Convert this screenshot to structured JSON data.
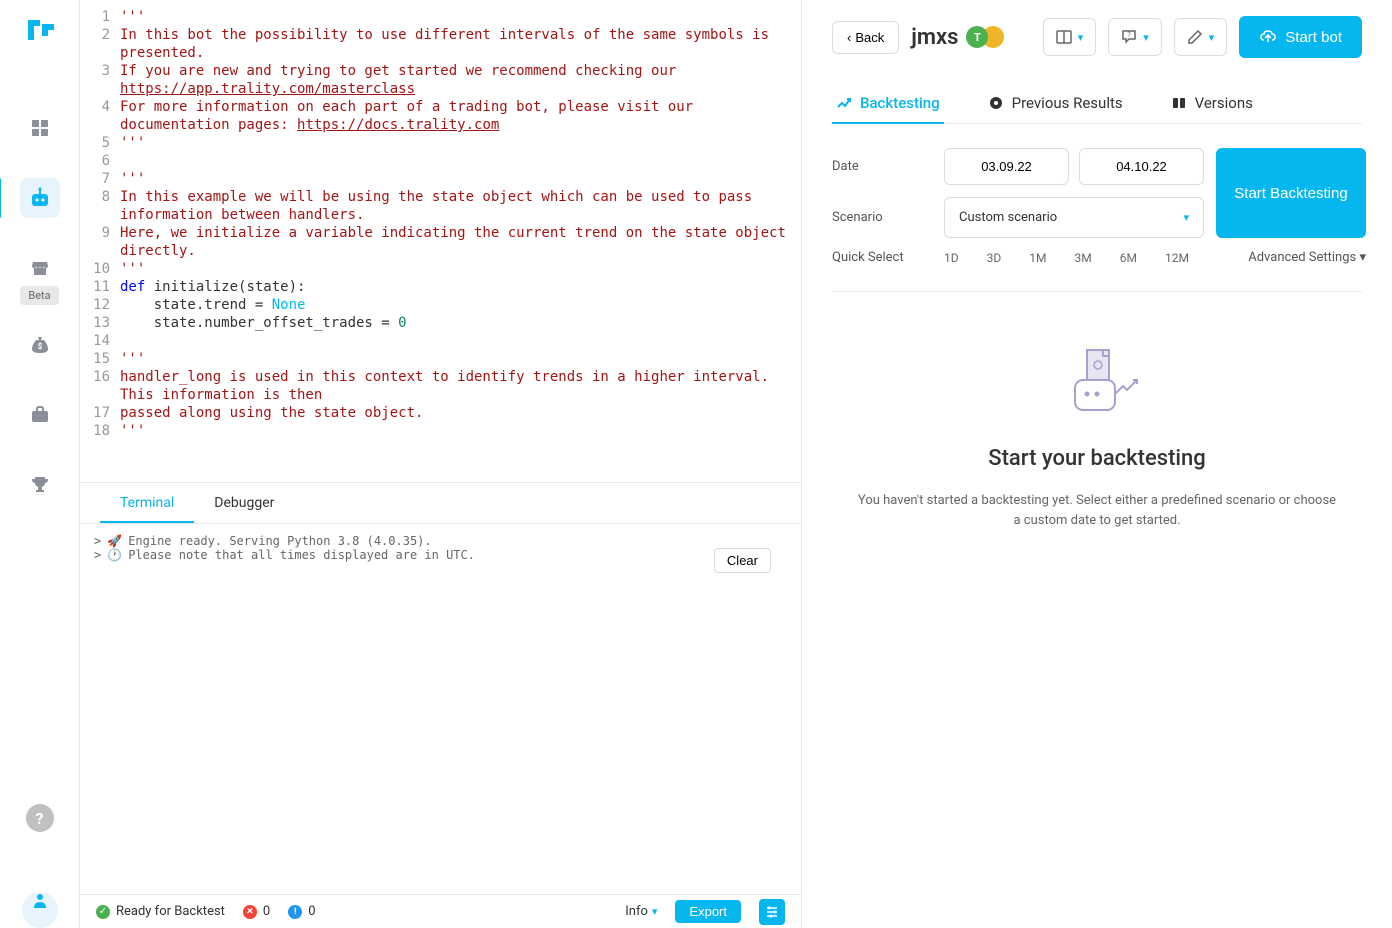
{
  "sidebar": {
    "beta_label": "Beta"
  },
  "editor": {
    "code_lines": [
      {
        "n": 1,
        "tokens": [
          {
            "t": "'''",
            "c": "str"
          }
        ]
      },
      {
        "n": 2,
        "tokens": [
          {
            "t": "In this bot the possibility to use different intervals of the same symbols is presented.",
            "c": "str"
          }
        ]
      },
      {
        "n": 3,
        "tokens": [
          {
            "t": "If you are new and trying to get started we recommend checking our ",
            "c": "str"
          },
          {
            "t": "https://app.trality.com/masterclass",
            "c": "str lnk"
          }
        ]
      },
      {
        "n": 4,
        "tokens": [
          {
            "t": "For more information on each part of a trading bot, please visit our documentation pages: ",
            "c": "str"
          },
          {
            "t": "https://docs.trality.com",
            "c": "str lnk"
          }
        ]
      },
      {
        "n": 5,
        "tokens": [
          {
            "t": "'''",
            "c": "str"
          }
        ]
      },
      {
        "n": 6,
        "tokens": [
          {
            "t": "",
            "c": ""
          }
        ]
      },
      {
        "n": 7,
        "tokens": [
          {
            "t": "'''",
            "c": "str"
          }
        ]
      },
      {
        "n": 8,
        "tokens": [
          {
            "t": "In this example we will be using the state object which can be used to pass information between handlers.",
            "c": "str"
          }
        ]
      },
      {
        "n": 9,
        "tokens": [
          {
            "t": "Here, we initialize a variable indicating the current trend on the state object directly.",
            "c": "str"
          }
        ]
      },
      {
        "n": 10,
        "tokens": [
          {
            "t": "'''",
            "c": "str"
          }
        ]
      },
      {
        "n": 11,
        "tokens": [
          {
            "t": "def",
            "c": "kw"
          },
          {
            "t": " initialize(state):",
            "c": ""
          }
        ]
      },
      {
        "n": 12,
        "tokens": [
          {
            "t": "    state.trend = ",
            "c": ""
          },
          {
            "t": "None",
            "c": "kw2"
          }
        ]
      },
      {
        "n": 13,
        "tokens": [
          {
            "t": "    state.number_offset_trades = ",
            "c": ""
          },
          {
            "t": "0",
            "c": "num"
          }
        ]
      },
      {
        "n": 14,
        "tokens": [
          {
            "t": "",
            "c": ""
          }
        ]
      },
      {
        "n": 15,
        "tokens": [
          {
            "t": "'''",
            "c": "str"
          }
        ]
      },
      {
        "n": 16,
        "tokens": [
          {
            "t": "handler_long is used in this context to identify trends in a higher interval. This information is then",
            "c": "str"
          }
        ]
      },
      {
        "n": 17,
        "tokens": [
          {
            "t": "passed along using the state object.",
            "c": "str"
          }
        ]
      },
      {
        "n": 18,
        "tokens": [
          {
            "t": "'''",
            "c": "str"
          }
        ]
      }
    ]
  },
  "terminal_tabs": {
    "terminal": "Terminal",
    "debugger": "Debugger"
  },
  "terminal": {
    "line1": "Engine ready. Serving Python 3.8 (4.0.35).",
    "line2": "Please note that all times displayed are in UTC.",
    "clear": "Clear"
  },
  "status": {
    "ready": "Ready for Backtest",
    "errors": "0",
    "warnings": "0",
    "info": "Info",
    "export": "Export"
  },
  "right": {
    "back": "Back",
    "bot_name": "jmxs",
    "badge_text": "T",
    "start_bot": "Start bot",
    "tabs": {
      "backtesting": "Backtesting",
      "previous": "Previous Results",
      "versions": "Versions"
    },
    "form": {
      "date_label": "Date",
      "date_from": "03.09.22",
      "date_to": "04.10.22",
      "scenario_label": "Scenario",
      "scenario_value": "Custom scenario",
      "start_backtest": "Start Backtesting",
      "quick_label": "Quick Select",
      "quick": [
        "1D",
        "3D",
        "1M",
        "3M",
        "6M",
        "12M"
      ],
      "advanced": "Advanced Settings ▾"
    },
    "empty": {
      "title": "Start your backtesting",
      "text": "You haven't started a backtesting yet. Select either a predefined scenario or choose a custom date to get started."
    }
  }
}
